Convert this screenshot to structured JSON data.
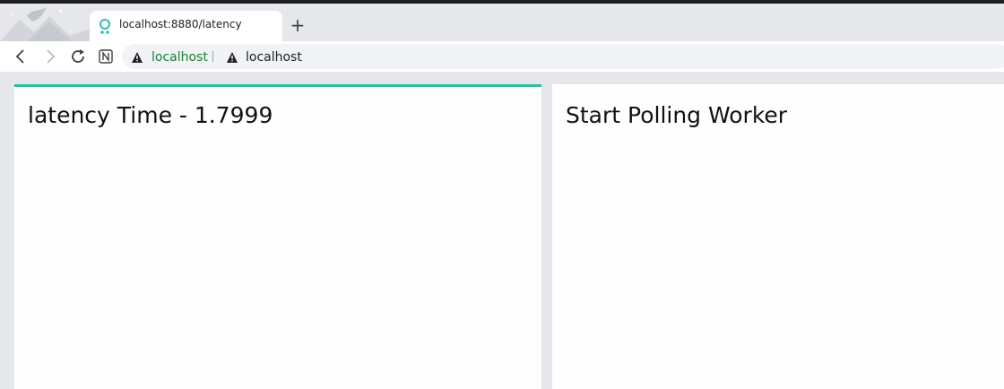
{
  "browser": {
    "tab": {
      "title": "localhost:8880/latency",
      "favicon": "loading-spinner-icon"
    },
    "new_tab_label": "+",
    "address": {
      "security_icon": "warning-icon",
      "host_label": "localhost",
      "origin_text": "localhost"
    },
    "nav": {
      "back": "back-arrow-icon",
      "forward": "forward-arrow-icon",
      "reload": "reload-icon",
      "extension": "notion-icon"
    },
    "colors": {
      "accent": "#2fbf9e",
      "host_label": "#188038"
    }
  },
  "page": {
    "left_panel": {
      "heading": "latency Time - 1.7999"
    },
    "right_panel": {
      "heading": "Start Polling Worker"
    }
  }
}
